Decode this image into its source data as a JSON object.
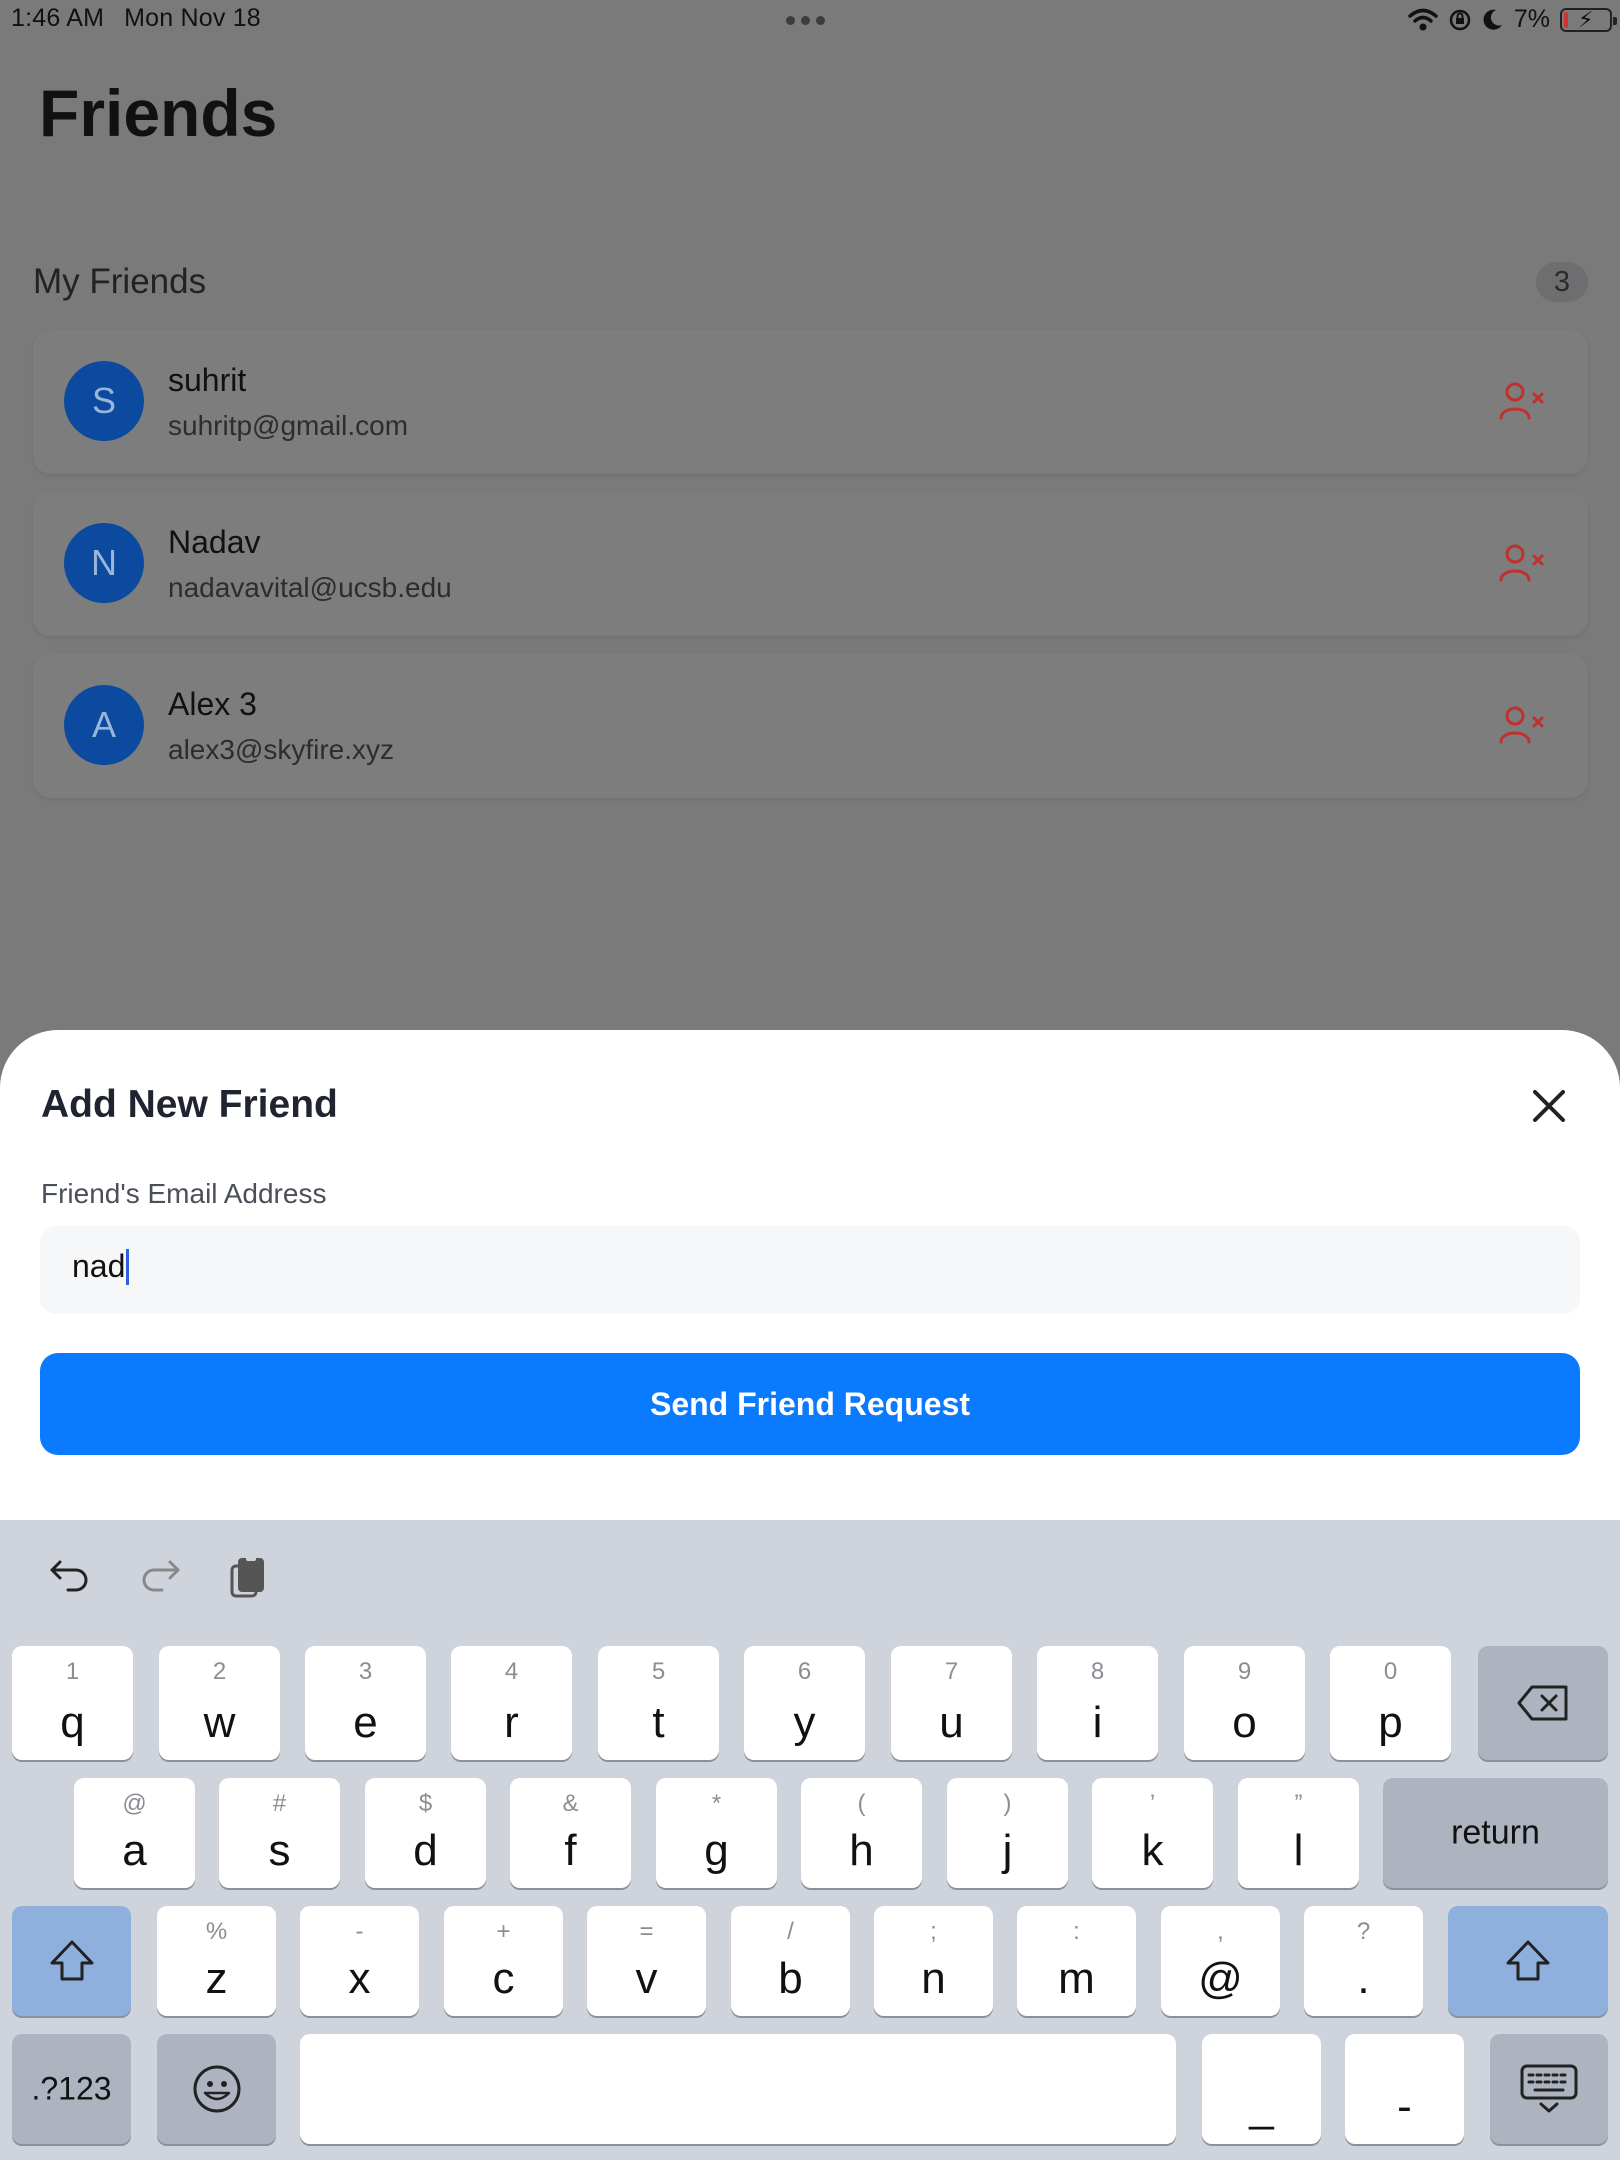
{
  "status_bar": {
    "time": "1:46 AM",
    "date": "Mon Nov 18",
    "battery": "7%",
    "battery_level": 0.07,
    "icons": [
      "wifi-icon",
      "orientation-lock-icon",
      "moon-icon",
      "battery-charging-icon"
    ]
  },
  "page": {
    "title": "Friends",
    "section_title": "My Friends",
    "friend_count": "3"
  },
  "friends": [
    {
      "initial": "S",
      "name": "suhrit",
      "email": "suhritp@gmail.com"
    },
    {
      "initial": "N",
      "name": "Nadav",
      "email": "nadavavital@ucsb.edu"
    },
    {
      "initial": "A",
      "name": "Alex 3",
      "email": "alex3@skyfire.xyz"
    }
  ],
  "sheet": {
    "title": "Add New Friend",
    "field_label": "Friend's Email Address",
    "email_value": "nad",
    "submit_label": "Send Friend Request"
  },
  "colors": {
    "accent": "#0a7afe",
    "avatar": "#0b4a9e",
    "remove": "#c0302c"
  },
  "keyboard": {
    "row1": [
      {
        "main": "q",
        "sub": "1"
      },
      {
        "main": "w",
        "sub": "2"
      },
      {
        "main": "e",
        "sub": "3"
      },
      {
        "main": "r",
        "sub": "4"
      },
      {
        "main": "t",
        "sub": "5"
      },
      {
        "main": "y",
        "sub": "6"
      },
      {
        "main": "u",
        "sub": "7"
      },
      {
        "main": "i",
        "sub": "8"
      },
      {
        "main": "o",
        "sub": "9"
      },
      {
        "main": "p",
        "sub": "0"
      }
    ],
    "row2": [
      {
        "main": "a",
        "sub": "@"
      },
      {
        "main": "s",
        "sub": "#"
      },
      {
        "main": "d",
        "sub": "$"
      },
      {
        "main": "f",
        "sub": "&"
      },
      {
        "main": "g",
        "sub": "*"
      },
      {
        "main": "h",
        "sub": "("
      },
      {
        "main": "j",
        "sub": ")"
      },
      {
        "main": "k",
        "sub": "’"
      },
      {
        "main": "l",
        "sub": "”"
      }
    ],
    "row3": [
      {
        "main": "z",
        "sub": "%"
      },
      {
        "main": "x",
        "sub": "-"
      },
      {
        "main": "c",
        "sub": "+"
      },
      {
        "main": "v",
        "sub": "="
      },
      {
        "main": "b",
        "sub": "/"
      },
      {
        "main": "n",
        "sub": ";"
      },
      {
        "main": "m",
        "sub": ":"
      },
      {
        "main": "@",
        "sub": ","
      },
      {
        "main": ".",
        "sub": "?"
      }
    ],
    "return_label": "return",
    "numbers_label": ".?123",
    "underscore_label": "_",
    "dash_label": "-"
  }
}
